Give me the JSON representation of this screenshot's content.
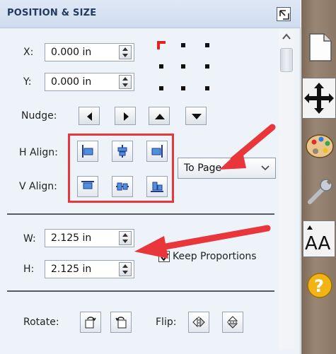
{
  "panel": {
    "title": "POSITION & SIZE"
  },
  "position": {
    "x_label": "X:",
    "x_value": "0.000 in",
    "y_label": "Y:",
    "y_value": "0.000 in"
  },
  "nudge": {
    "label": "Nudge:"
  },
  "align": {
    "h_label": "H Align:",
    "v_label": "V Align:",
    "relative_to": "To Page"
  },
  "size": {
    "w_label": "W:",
    "w_value": "2.125 in",
    "h_label": "H:",
    "h_value": "2.125 in",
    "keep_proportions_label": "Keep Proportions",
    "keep_proportions_checked": true
  },
  "transform": {
    "rotate_label": "Rotate:",
    "flip_label": "Flip:"
  },
  "colors": {
    "highlight": "#e8363a",
    "panel_bg": "#eef3fa"
  },
  "sidebar": {
    "items": [
      "page-icon",
      "move-icon",
      "palette-icon",
      "wrench-icon",
      "text-size-icon",
      "help-icon"
    ]
  }
}
